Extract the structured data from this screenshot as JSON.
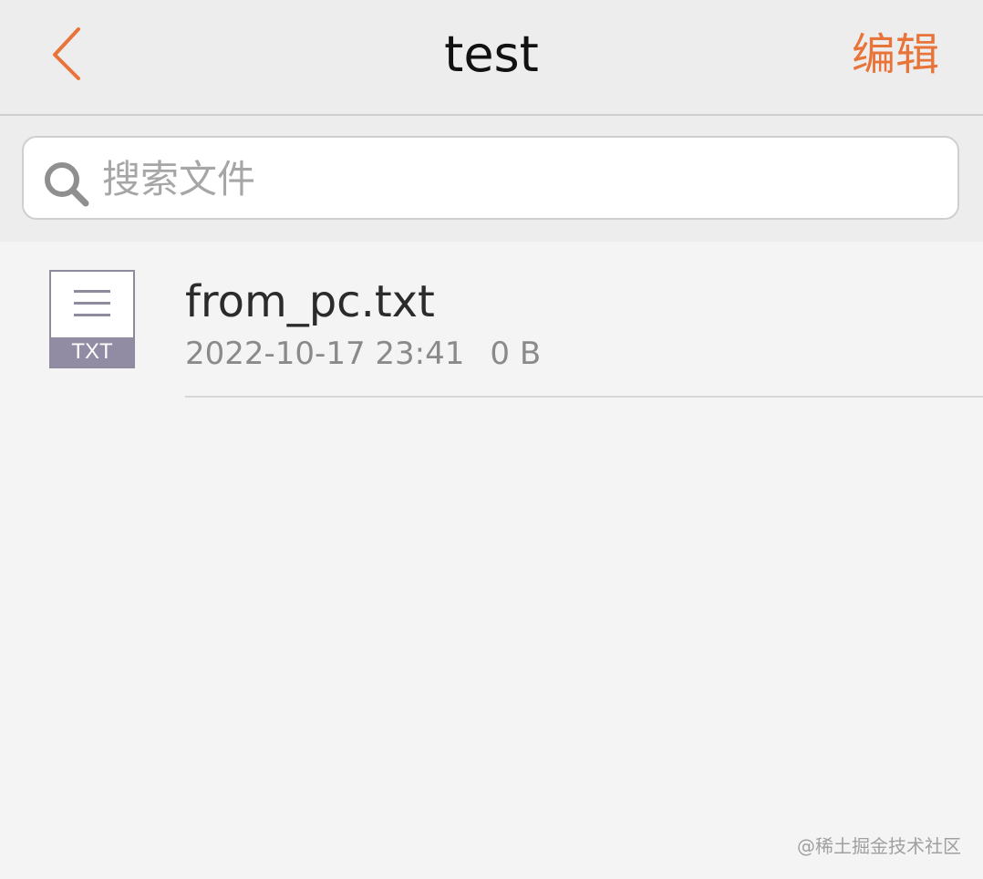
{
  "navbar": {
    "back_icon": "chevron-left-icon",
    "title": "test",
    "edit_label": "编辑"
  },
  "search": {
    "icon": "search-icon",
    "placeholder": "搜索文件",
    "value": ""
  },
  "files": [
    {
      "icon": "txt-file-icon",
      "type_label": "TXT",
      "name": "from_pc.txt",
      "date": "2022-10-17 23:41",
      "size": "0 B"
    }
  ],
  "watermark": "@稀土掘金技术社区",
  "colors": {
    "accent": "#e8743a",
    "nav_background": "#ededed",
    "content_background": "#f4f4f4",
    "file_icon": "#918ca3"
  }
}
